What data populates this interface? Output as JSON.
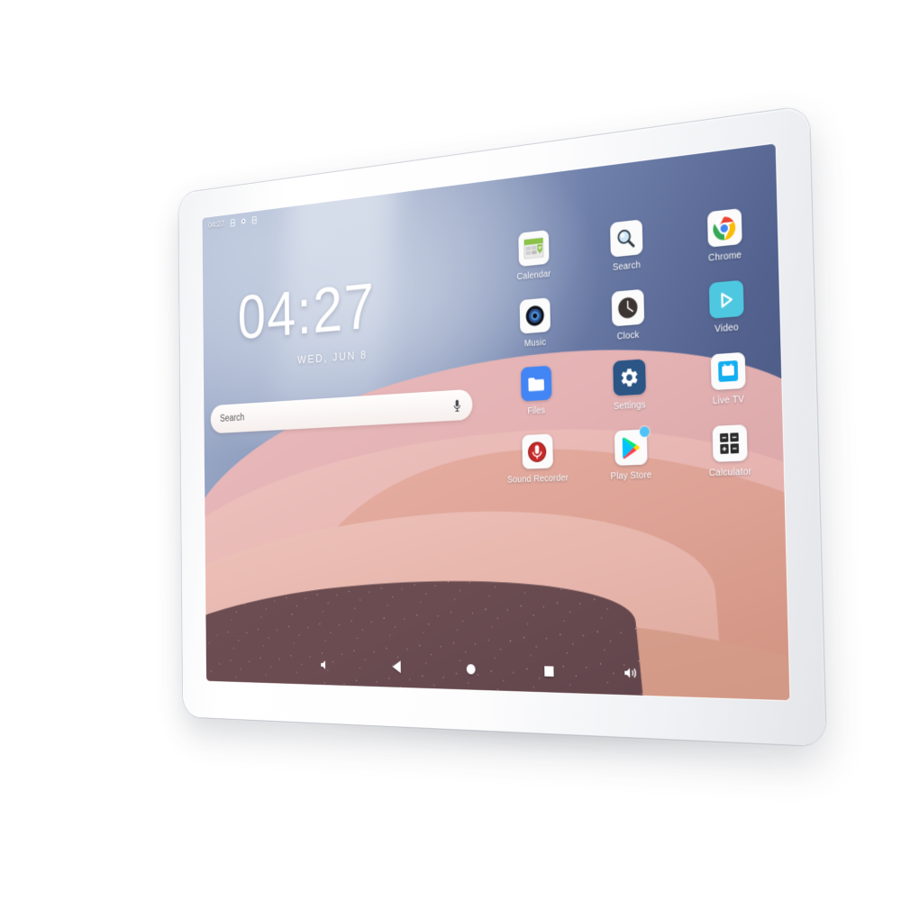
{
  "device": {
    "type": "android-tablet",
    "bezel_color": "#ffffff",
    "orientation": "landscape"
  },
  "status_bar": {
    "time": "04:27",
    "icons": [
      "sim-icon",
      "location-icon",
      "battery-icon"
    ]
  },
  "clock_widget": {
    "time": "04:27",
    "date": "WED, JUN 8"
  },
  "search": {
    "placeholder": "Search",
    "value": "",
    "mic_icon": "microphone-icon"
  },
  "apps": [
    {
      "label": "Calendar",
      "icon": "calendar-icon",
      "badge": false
    },
    {
      "label": "Search",
      "icon": "magnifier-icon",
      "badge": false
    },
    {
      "label": "Chrome",
      "icon": "chrome-icon",
      "badge": false
    },
    {
      "label": "Music",
      "icon": "music-icon",
      "badge": false
    },
    {
      "label": "Clock",
      "icon": "clock-icon",
      "badge": false
    },
    {
      "label": "Video",
      "icon": "video-play-icon",
      "badge": false
    },
    {
      "label": "Files",
      "icon": "folder-icon",
      "badge": false
    },
    {
      "label": "Settings",
      "icon": "gear-icon",
      "badge": false
    },
    {
      "label": "Live TV",
      "icon": "tv-icon",
      "badge": false
    },
    {
      "label": "Sound Recorder",
      "icon": "record-mic-icon",
      "badge": false
    },
    {
      "label": "Play Store",
      "icon": "play-store-icon",
      "badge": true
    },
    {
      "label": "Calculator",
      "icon": "calculator-icon",
      "badge": false
    }
  ],
  "nav_bar": {
    "buttons": [
      {
        "name": "volume-down-icon"
      },
      {
        "name": "back-icon"
      },
      {
        "name": "home-icon"
      },
      {
        "name": "recents-icon"
      },
      {
        "name": "volume-up-icon"
      }
    ]
  },
  "wallpaper": {
    "description": "desert dunes",
    "sky_top": "#a7b4cf",
    "sky_bottom": "#47557e",
    "dune_light": "#e8b9bc",
    "dune_mid": "#e7b0a4",
    "dune_dark": "#6d4f53"
  },
  "colors": {
    "accent": "#4285f4",
    "badge": "#4fc3f7",
    "settings_tile": "#2a5585",
    "video_tile": "#4ec8e0"
  }
}
